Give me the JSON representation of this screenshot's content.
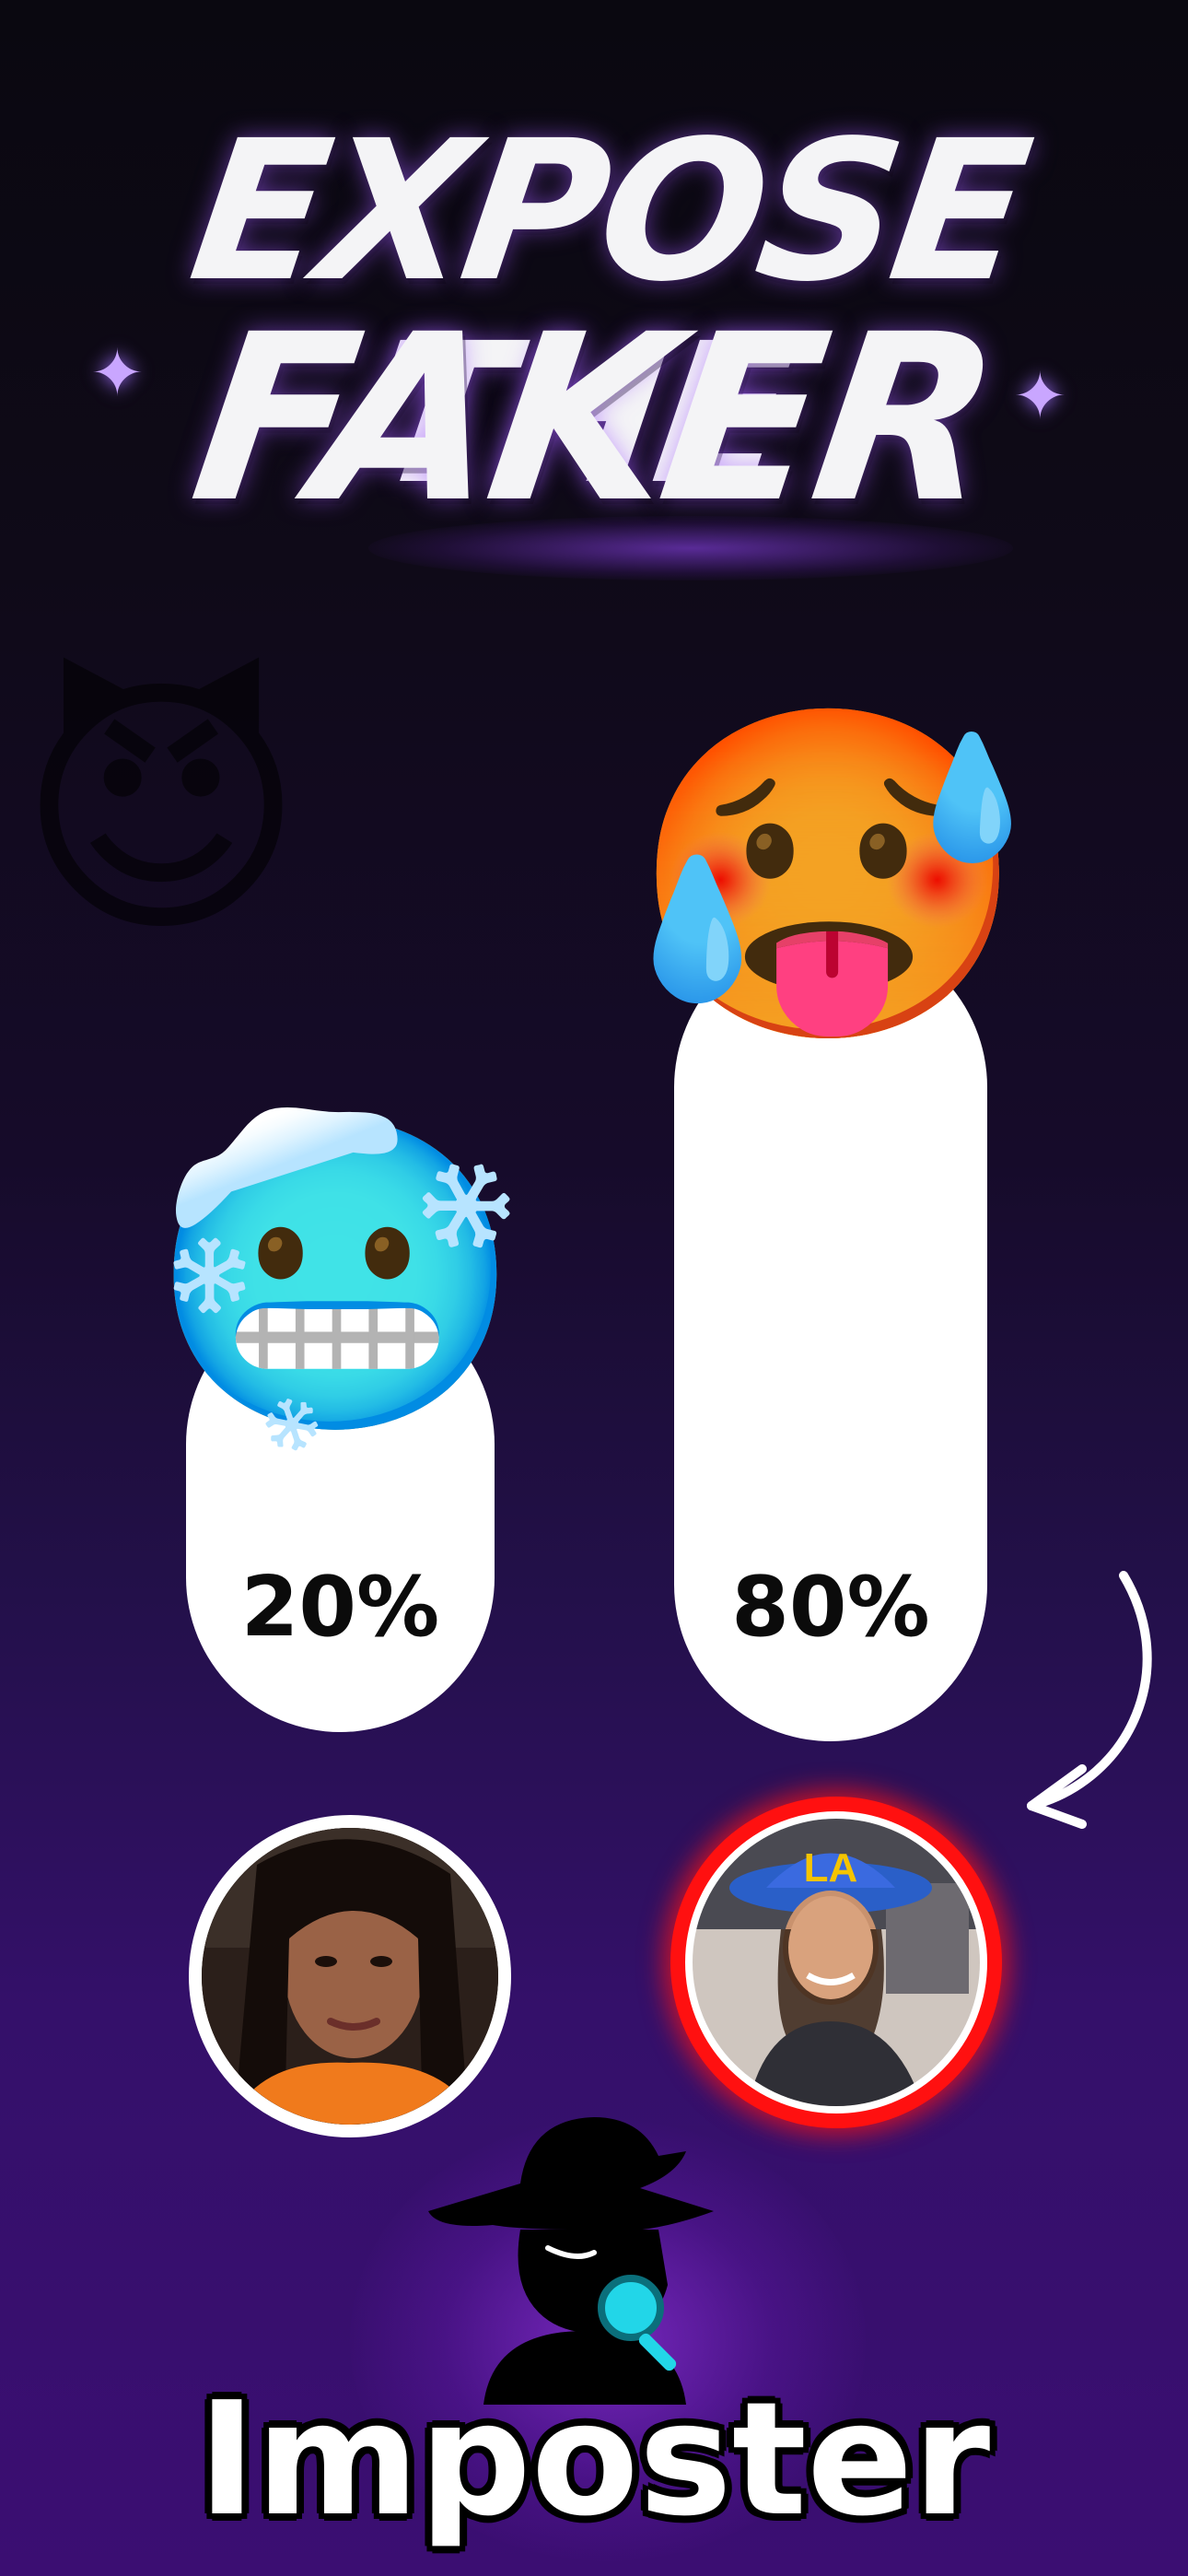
{
  "headline": {
    "line1": "EXPOSE THE",
    "line2": "FAKER"
  },
  "decor": {
    "sparkle_glyph": "✦",
    "devil_emoji": "😈",
    "accent_color": "#8a3cff"
  },
  "poll": {
    "options": [
      {
        "emoji": "🥶",
        "emoji_name": "cold-face",
        "percent_label": "20%",
        "value": 20
      },
      {
        "emoji": "🥵",
        "emoji_name": "hot-face",
        "percent_label": "80%",
        "value": 80
      }
    ],
    "highlight_color": "#ff1010"
  },
  "brand": {
    "name": "Imposter",
    "icon": "spy-silhouette-with-magnifier"
  }
}
